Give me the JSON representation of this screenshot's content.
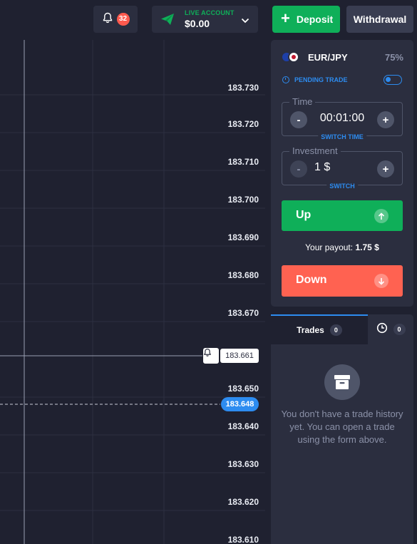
{
  "header": {
    "notifications_count": "32",
    "account_type_label": "LIVE ACCOUNT",
    "balance": "$0.00",
    "deposit_label": "Deposit",
    "withdrawal_label": "Withdrawal",
    "colors": {
      "green": "#0faf59",
      "blue": "#2d8cf0",
      "red": "#ff6251"
    }
  },
  "chart": {
    "price_levels": [
      "183.730",
      "183.720",
      "183.710",
      "183.700",
      "183.690",
      "183.680",
      "183.670",
      "183.650",
      "183.640",
      "183.630",
      "183.620",
      "183.610"
    ],
    "current_price": "183.661",
    "open_price": "183.648"
  },
  "trade": {
    "pair": "EUR/JPY",
    "payout_percent": "75%",
    "pending_label": "PENDING TRADE",
    "time_label": "Time",
    "time_value": "00:01:00",
    "switch_time_label": "SWITCH TIME",
    "investment_label": "Investment",
    "investment_value": "1 $",
    "switch_label": "SWITCH",
    "up_label": "Up",
    "payout_label": "Your payout:",
    "payout_value": "1.75 $",
    "down_label": "Down"
  },
  "trades": {
    "tab_label": "Trades",
    "trades_count": "0",
    "history_count": "0",
    "empty_message": "You don't have a trade history yet. You can open a trade using the form above."
  }
}
